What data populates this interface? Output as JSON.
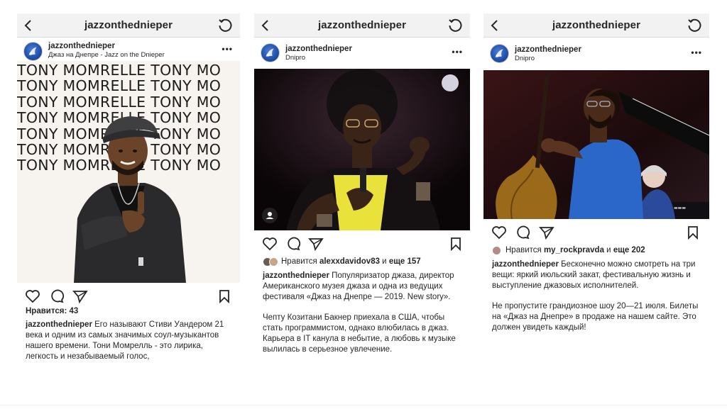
{
  "posts": [
    {
      "topbar_title": "jazzonthednieper",
      "username": "jazzonthednieper",
      "location": "Джаз на Днепре -  Jazz on the Dnieper",
      "image_text_lines": [
        "TONY MOMRELLE TONY MO",
        "TONY MOMRELLE TONY MO",
        "TONY MOMRELLE TONY MO",
        "TONY MOMRELLE TONY MO",
        "TONY MOMRELLE TONY MO",
        "TONY MOMRELLE TONY MO",
        "TONY MOMRELLE TONY MO"
      ],
      "likes": "Нравится: 43",
      "caption_user": "jazzonthednieper",
      "caption": " Его называют Стиви Уандером 21 века и одним из самых значимых соул-музыкантов нашего времени. Тони Момрелль - это лирика, легкость и незабываемый голос,"
    },
    {
      "topbar_title": "jazzonthednieper",
      "username": "jazzonthednieper",
      "location": "Dnipro",
      "likes_prefix": "Нравится ",
      "likes_user": "alexxdavidov83",
      "likes_mid": " и ",
      "likes_count": "еще 157",
      "caption_user": "jazzonthednieper",
      "caption": " Популяризатор джаза, директор Американского музея джаза и одна из ведущих фестиваля «Джаз на Днепре — 2019. New story».",
      "caption_p2": "Чепту Козитани Бакнер приехала в США, чтобы стать программистом, однако влюбилась в джаз. Карьера в IT канула в небытие, а любовь к музыке вылилась в серьезное увлечение."
    },
    {
      "topbar_title": "jazzonthednieper",
      "username": "jazzonthednieper",
      "location": "Dnipro",
      "likes_prefix": "Нравится ",
      "likes_user": "my_rockpravda",
      "likes_mid": " и ",
      "likes_count": "еще 202",
      "caption_user": "jazzonthednieper",
      "caption": " Бесконечно можно смотреть на три вещи: яркий июльский закат, фестивальную жизнь и выступление джазовых исполнителей.",
      "caption_p2": "Не пропустите грандиозное шоу 20—21 июля. Билеты на «Джаз на Днепре» в продаже на нашем сайте. Это должен увидеть каждый!"
    }
  ],
  "icons": {
    "back": "chevron-left-icon",
    "refresh": "refresh-icon",
    "more": "more-options-icon",
    "like": "heart-icon",
    "comment": "comment-icon",
    "share": "send-icon",
    "save": "bookmark-icon",
    "tag": "user-tag-icon"
  },
  "colors": {
    "bar_bg": "#f2f2f2",
    "text": "#262626",
    "avatar_blue": "#1f4ea8",
    "stage_yellow": "#e9e23a",
    "shirt_blue": "#2a67c9"
  }
}
